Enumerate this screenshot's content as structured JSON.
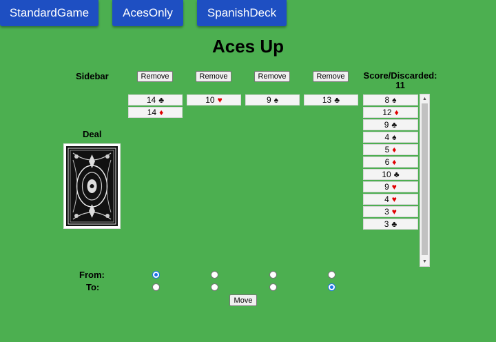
{
  "top_buttons": [
    "StandardGame",
    "AcesOnly",
    "SpanishDeck"
  ],
  "title": "Aces Up",
  "sidebar_label": "Sidebar",
  "remove_label": "Remove",
  "score": {
    "label": "Score/Discarded:",
    "value": "11"
  },
  "deal_label": "Deal",
  "columns": [
    [
      {
        "rank": "14",
        "suit": "♣",
        "color": "black"
      },
      {
        "rank": "14",
        "suit": "♦",
        "color": "red"
      }
    ],
    [
      {
        "rank": "10",
        "suit": "♥",
        "color": "red"
      }
    ],
    [
      {
        "rank": "9",
        "suit": "♠",
        "color": "black"
      }
    ],
    [
      {
        "rank": "13",
        "suit": "♣",
        "color": "black"
      }
    ]
  ],
  "discard_pile": [
    {
      "rank": "8",
      "suit": "♠",
      "color": "black"
    },
    {
      "rank": "12",
      "suit": "♦",
      "color": "red"
    },
    {
      "rank": "9",
      "suit": "♣",
      "color": "black"
    },
    {
      "rank": "4",
      "suit": "♠",
      "color": "black"
    },
    {
      "rank": "5",
      "suit": "♦",
      "color": "red"
    },
    {
      "rank": "6",
      "suit": "♦",
      "color": "red"
    },
    {
      "rank": "10",
      "suit": "♣",
      "color": "black"
    },
    {
      "rank": "9",
      "suit": "♥",
      "color": "red"
    },
    {
      "rank": "4",
      "suit": "♥",
      "color": "red"
    },
    {
      "rank": "3",
      "suit": "♥",
      "color": "red"
    },
    {
      "rank": "3",
      "suit": "♣",
      "color": "black"
    }
  ],
  "from_label": "From:",
  "to_label": "To:",
  "from_selected": 0,
  "to_selected": 3,
  "move_label": "Move",
  "colors": {
    "background": "#4caf50",
    "button": "#1e4fc2",
    "red_suit": "#e00000"
  }
}
